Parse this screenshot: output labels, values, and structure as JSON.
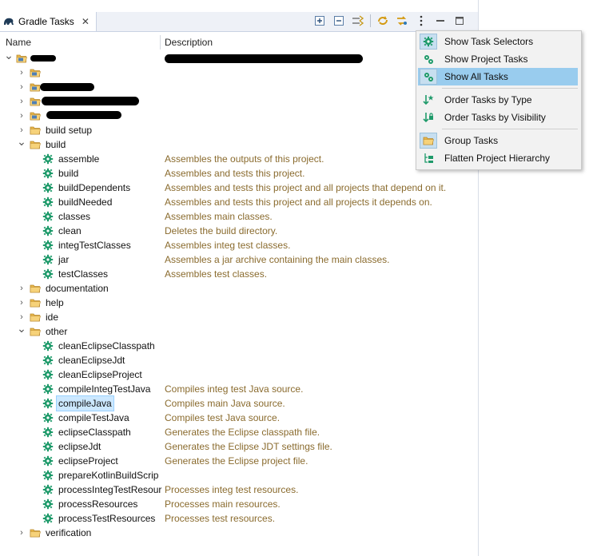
{
  "tab": {
    "title": "Gradle Tasks",
    "close": "✕"
  },
  "toolbar": {
    "icons": [
      "expand-all-icon",
      "collapse-all-icon",
      "link-editor-icon",
      "refresh-icon",
      "run-icon",
      "view-menu-icon",
      "minimize-icon",
      "maximize-icon"
    ]
  },
  "columns": {
    "name": "Name",
    "description": "Description"
  },
  "colors": {
    "description_text": "#8a6b2e",
    "task_icon": "#1e9a6a",
    "folder": "#e9b84a",
    "menu_highlight": "#99ccee",
    "selection": "#cce8ff"
  },
  "tree": {
    "root_label": "",
    "items": [
      {
        "label": "",
        "redacted": true
      },
      {
        "label": "",
        "redacted": true
      },
      {
        "label": "",
        "redacted": true
      },
      {
        "label": "",
        "redacted": true
      },
      {
        "label": "build setup"
      },
      {
        "label": "build"
      },
      {
        "label": "documentation"
      },
      {
        "label": "help"
      },
      {
        "label": "ide"
      },
      {
        "label": "other"
      },
      {
        "label": "verification"
      }
    ],
    "build_tasks": [
      {
        "name": "assemble",
        "desc": "Assembles the outputs of this project."
      },
      {
        "name": "build",
        "desc": "Assembles and tests this project."
      },
      {
        "name": "buildDependents",
        "desc": "Assembles and tests this project and all projects that depend on it."
      },
      {
        "name": "buildNeeded",
        "desc": "Assembles and tests this project and all projects it depends on."
      },
      {
        "name": "classes",
        "desc": "Assembles main classes."
      },
      {
        "name": "clean",
        "desc": "Deletes the build directory."
      },
      {
        "name": "integTestClasses",
        "desc": "Assembles integ test classes."
      },
      {
        "name": "jar",
        "desc": "Assembles a jar archive containing the main classes."
      },
      {
        "name": "testClasses",
        "desc": "Assembles test classes."
      }
    ],
    "other_tasks": [
      {
        "name": "cleanEclipseClasspath",
        "desc": ""
      },
      {
        "name": "cleanEclipseJdt",
        "desc": ""
      },
      {
        "name": "cleanEclipseProject",
        "desc": ""
      },
      {
        "name": "compileIntegTestJava",
        "desc": "Compiles integ test Java source."
      },
      {
        "name": "compileJava",
        "desc": "Compiles main Java source.",
        "selected": true
      },
      {
        "name": "compileTestJava",
        "desc": "Compiles test Java source."
      },
      {
        "name": "eclipseClasspath",
        "desc": "Generates the Eclipse classpath file."
      },
      {
        "name": "eclipseJdt",
        "desc": "Generates the Eclipse JDT settings file."
      },
      {
        "name": "eclipseProject",
        "desc": "Generates the Eclipse project file."
      },
      {
        "name": "prepareKotlinBuildScrip",
        "desc": ""
      },
      {
        "name": "processIntegTestResour",
        "desc": "Processes integ test resources."
      },
      {
        "name": "processResources",
        "desc": "Processes main resources."
      },
      {
        "name": "processTestResources",
        "desc": "Processes test resources."
      }
    ]
  },
  "menu": {
    "items": [
      {
        "label": "Show Task Selectors",
        "icon": "task-selector-icon",
        "checked": true,
        "highlighted": false
      },
      {
        "label": "Show Project Tasks",
        "icon": "project-tasks-icon",
        "checked": false,
        "highlighted": false
      },
      {
        "label": "Show All Tasks",
        "icon": "all-tasks-icon",
        "checked": true,
        "highlighted": true
      },
      {
        "label": "Order Tasks by Type",
        "icon": "sort-type-icon",
        "checked": false,
        "highlighted": false
      },
      {
        "label": "Order Tasks by Visibility",
        "icon": "sort-visibility-icon",
        "checked": false,
        "highlighted": false
      },
      {
        "label": "Group Tasks",
        "icon": "group-folder-icon",
        "checked": true,
        "highlighted": false
      },
      {
        "label": "Flatten Project Hierarchy",
        "icon": "flatten-hierarchy-icon",
        "checked": false,
        "highlighted": false
      }
    ]
  }
}
